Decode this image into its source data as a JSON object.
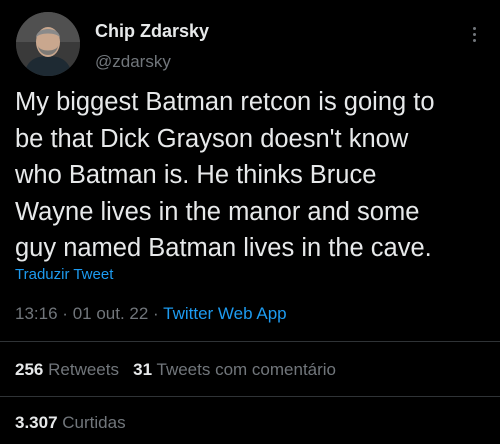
{
  "author": {
    "name": "Chip Zdarsky",
    "handle": "@zdarsky",
    "avatar_icon": "person-avatar"
  },
  "tweet": {
    "lines": [
      "My biggest Batman retcon is going to",
      "be that Dick Grayson doesn't know",
      "who Batman is. He thinks Bruce",
      "Wayne lives in the manor and some",
      "guy named Batman lives in the cave."
    ],
    "translate_label": "Traduzir Tweet"
  },
  "meta": {
    "time": "13:16",
    "separator": "·",
    "date": "01 out. 22",
    "app": "Twitter Web App"
  },
  "stats": {
    "retweets_count": "256",
    "retweets_label": "Retweets",
    "quotes_count": "31",
    "quotes_label": "Tweets com comentário",
    "likes_count": "3.307",
    "likes_label": "Curtidas"
  },
  "colors": {
    "background": "#000000",
    "text": "#e7e9ea",
    "muted": "#71767b",
    "accent": "#1d9bf0",
    "divider": "#2f3336"
  }
}
